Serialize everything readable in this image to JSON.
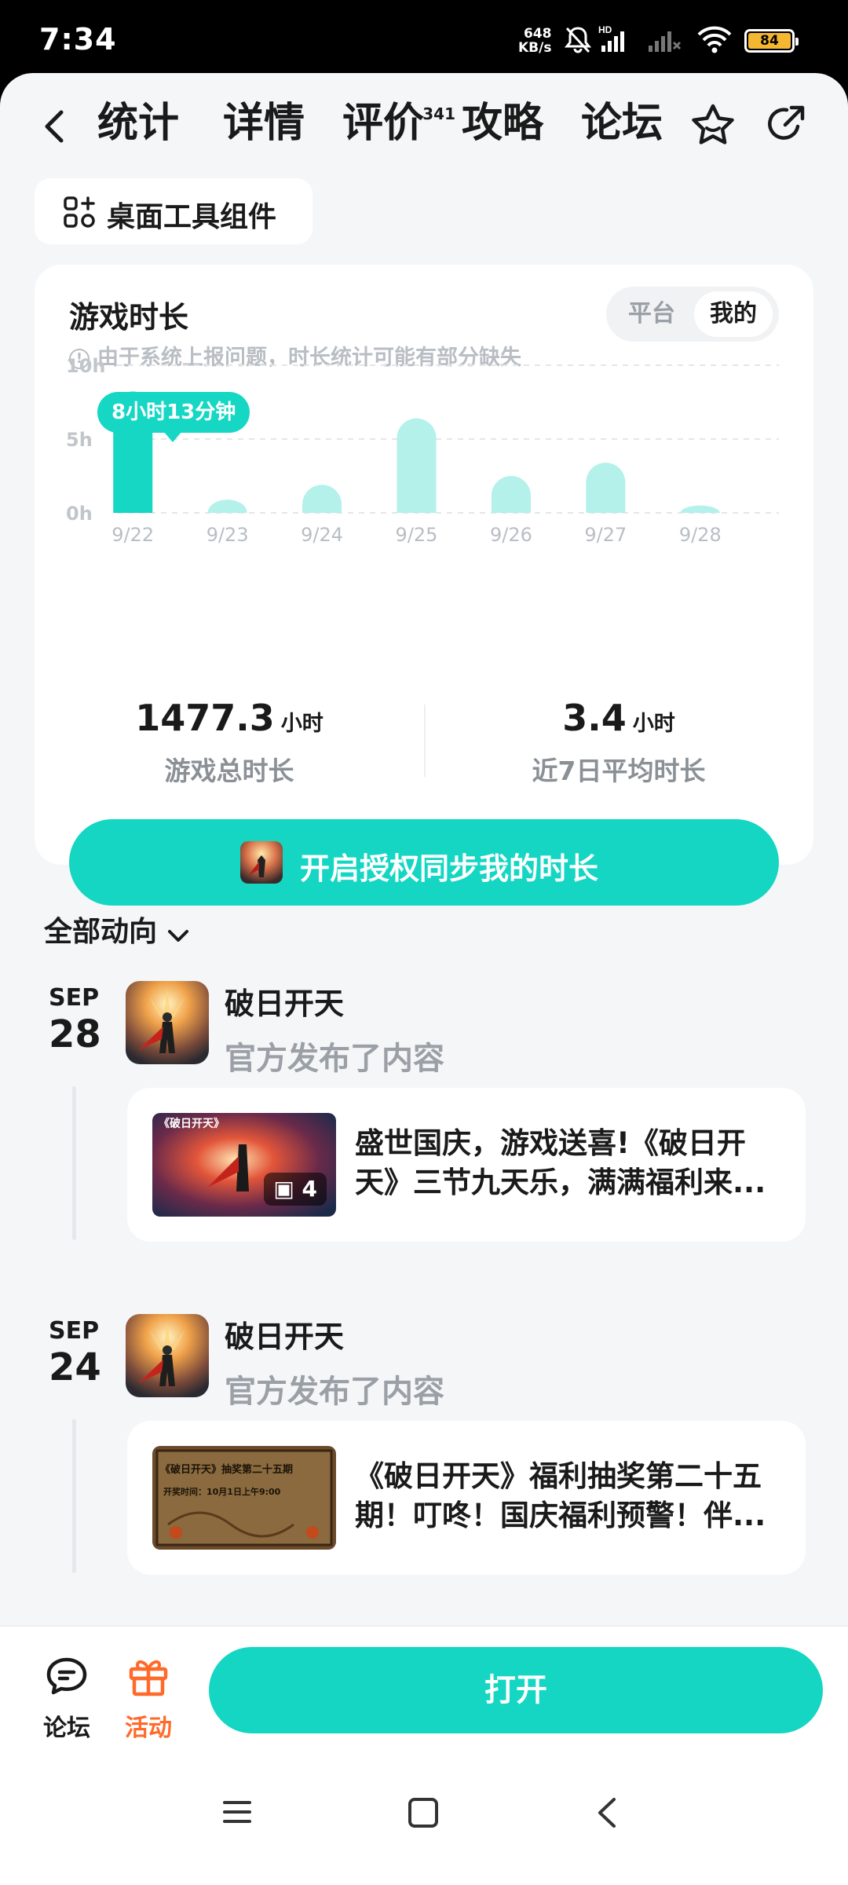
{
  "status": {
    "time": "7:34",
    "net_speed_top": "648",
    "net_speed_bottom": "KB/s",
    "battery": "84"
  },
  "nav": {
    "tabs": [
      {
        "label": "统计"
      },
      {
        "label": "详情"
      },
      {
        "label": "评价",
        "badge": "341"
      },
      {
        "label": "攻略"
      },
      {
        "label": "论坛"
      }
    ]
  },
  "widget_chip": {
    "label": "桌面工具组件"
  },
  "playtime": {
    "title": "游戏时长",
    "note": "由于系统上报问题，时长统计可能有部分缺失",
    "segment": {
      "left": "平台",
      "right": "我的"
    },
    "tooltip": "8小时13分钟",
    "total": {
      "value": "1477.3",
      "unit": "小时",
      "label": "游戏总时长"
    },
    "avg": {
      "value": "3.4",
      "unit": "小时",
      "label": "近7日平均时长"
    },
    "auth_button": "开启授权同步我的时长"
  },
  "chart_data": {
    "type": "bar",
    "categories": [
      "9/22",
      "9/23",
      "9/24",
      "9/25",
      "9/26",
      "9/27",
      "9/28"
    ],
    "values": [
      8.22,
      0.9,
      1.9,
      6.4,
      2.5,
      3.4,
      0.5
    ],
    "ytick_labels": [
      "10h",
      "5h",
      "0h"
    ],
    "ylim": [
      0,
      10
    ],
    "highlight_index": 0,
    "colors": {
      "highlight": "#15d7c4",
      "normal": "#b3f1ea"
    }
  },
  "section": {
    "label": "全部动向"
  },
  "feed": [
    {
      "month": "SEP",
      "day": "28",
      "game": "破日开天",
      "action": "官方发布了内容",
      "post_text": "盛世国庆，游戏送喜!《破日开天》三节九天乐，满满福利来...",
      "image_count": "4",
      "thumb_title": "《破日开天》"
    },
    {
      "month": "SEP",
      "day": "24",
      "game": "破日开天",
      "action": "官方发布了内容",
      "post_text": "《破日开天》福利抽奖第二十五期！叮咚！国庆福利预警！伴...",
      "thumb_title": "《破日开天》抽奖第二十五期",
      "thumb_sub": "开奖时间：10月1日上午9:00"
    }
  ],
  "bottom": {
    "forum": "论坛",
    "activity": "活动",
    "open": "打开"
  },
  "colors": {
    "accent": "#14d6c3",
    "activity": "#ff6a2b"
  }
}
